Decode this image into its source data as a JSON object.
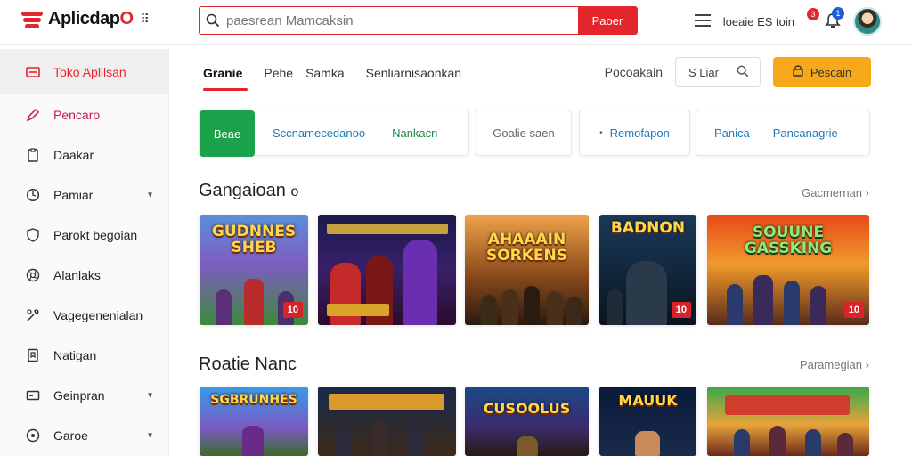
{
  "app": {
    "logo_text_main": "Aplicdap",
    "logo_text_accent": "O",
    "logo_grid_glyph": "⠿"
  },
  "search": {
    "value": "",
    "placeholder": "paesrean Mamcaksin",
    "button_label": "Paoer"
  },
  "topbar": {
    "lang_text": "loeaie ES toin",
    "notification_count": "3",
    "bell_count": "1"
  },
  "sidebar": {
    "items": [
      {
        "label": "Toko Aplilsan",
        "icon": "store-icon",
        "active": true
      },
      {
        "label": "Pencaro",
        "icon": "pen-icon"
      },
      {
        "label": "Daakar",
        "icon": "file-icon"
      },
      {
        "label": "Pamiar",
        "icon": "clock-icon",
        "chevron": true
      },
      {
        "label": "Parokt begoian",
        "icon": "shield-icon"
      },
      {
        "label": "Alanlaks",
        "icon": "aperture-icon"
      },
      {
        "label": "Vagegenenialan",
        "icon": "tools-icon"
      },
      {
        "label": "Natigan",
        "icon": "bookmark-icon"
      },
      {
        "label": "Geinpran",
        "icon": "card-icon",
        "chevron": true
      },
      {
        "label": "Garoe",
        "icon": "circle-icon",
        "chevron": true
      }
    ]
  },
  "main": {
    "tabs": [
      {
        "label": "Granie",
        "active": true
      },
      {
        "label": "Pehe"
      },
      {
        "label": "Samka"
      },
      {
        "label": "Senliarnisaonkan"
      }
    ],
    "filter_label": "Pocoakain",
    "sort_label": "S Liar",
    "primary_button": "Pescain",
    "chips": [
      {
        "label": "Beae",
        "style": "green"
      },
      {
        "label": "Sccnamecedanoo",
        "style": "blue"
      },
      {
        "label": "Nankacn",
        "style": "green-text"
      },
      {
        "label": "Goalie saen",
        "style": "grey"
      },
      {
        "label": "Remofapon",
        "style": "blue",
        "bullet": "•"
      },
      {
        "label": "Panica",
        "style": "blue"
      },
      {
        "label": "Pancanagrie",
        "style": "blue"
      }
    ],
    "section1": {
      "title": "Gangaioan",
      "title_suffix": "o",
      "link": "Gacmernan",
      "cards": [
        {
          "title": "GUDNNES SHEB",
          "sub": "",
          "badge": "10"
        },
        {
          "title": "",
          "sub": "",
          "badge": ""
        },
        {
          "title": "AHAAAIN SORKENS",
          "sub": "",
          "badge": ""
        },
        {
          "title": "BADNON",
          "sub": "",
          "badge": "10"
        },
        {
          "title": "SOUUNE GASSKING",
          "sub": "",
          "badge": "10"
        }
      ]
    },
    "section2": {
      "title": "Roatie Nanc",
      "link": "Paramegian",
      "cards": [
        {
          "title": "SGBRUNHES"
        },
        {
          "title": ""
        },
        {
          "title": "CUSOOLUS"
        },
        {
          "title": "MAUUK"
        },
        {
          "title": ""
        }
      ]
    }
  },
  "colors": {
    "accent": "#e4262c",
    "orange": "#f7a81b",
    "green": "#1aa34a",
    "link_blue": "#1f7ab8"
  }
}
